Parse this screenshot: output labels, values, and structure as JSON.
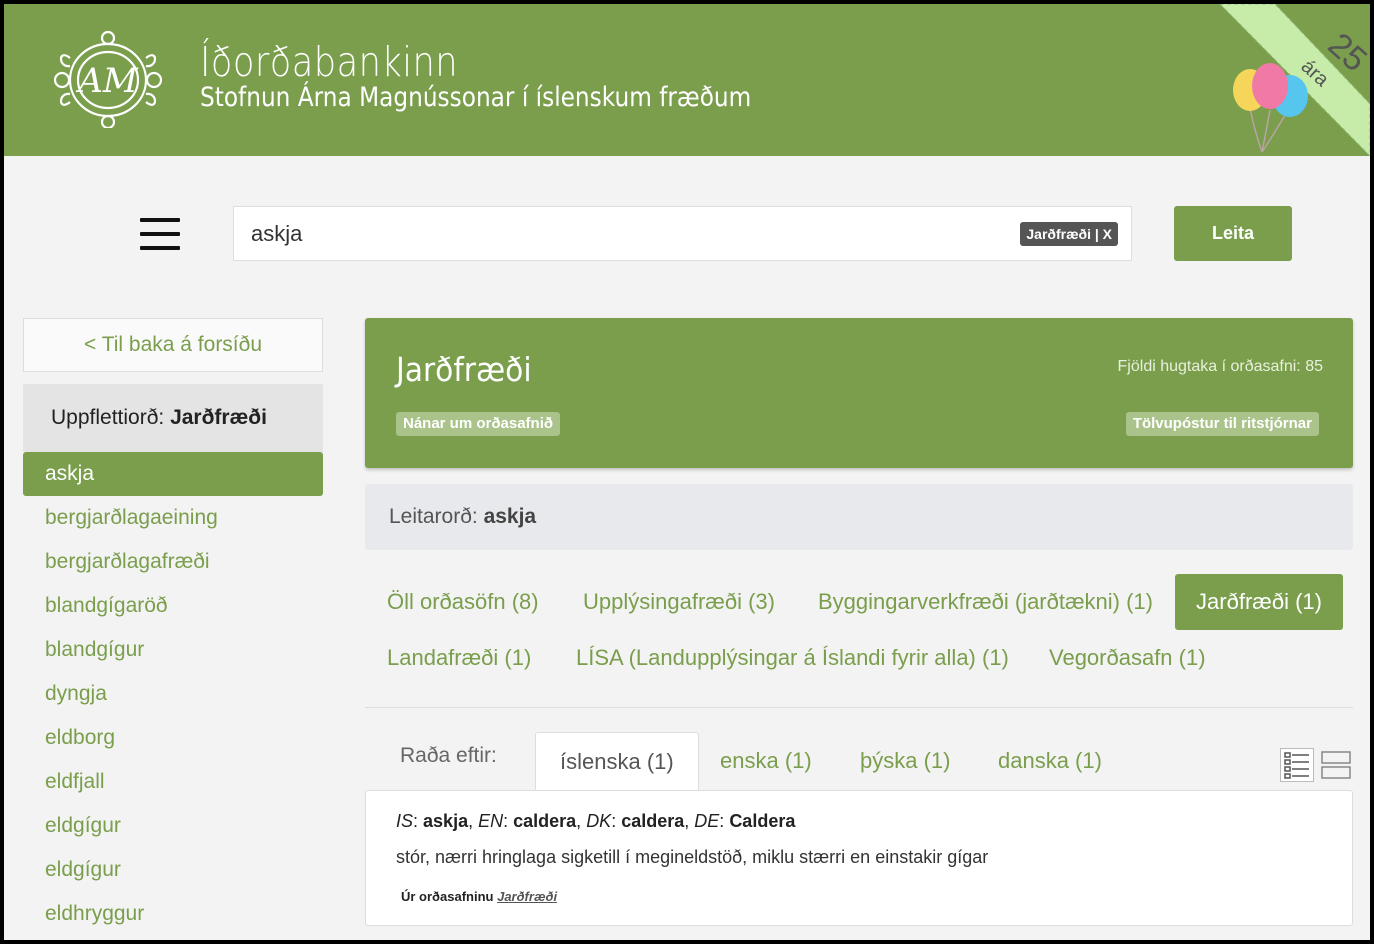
{
  "header": {
    "title": "Íðorðabankinn",
    "subtitle": "Stofnun Árna Magnússonar í íslenskum fræðum",
    "anniversary_number": "25",
    "anniversary_word": "ára",
    "logo_text": "AM",
    "color": "#7a9e4c"
  },
  "search": {
    "value": "askja",
    "filter_tag": "Jarðfræði | X",
    "button_label": "Leita"
  },
  "sidebar": {
    "back_label": "< Til baka á forsíðu",
    "lookup_label": "Uppflettiorð:",
    "lookup_value": "Jarðfræði",
    "words": [
      "askja",
      "bergjarðlagaeining",
      "bergjarðlagafræði",
      "blandgígaröð",
      "blandgígur",
      "dyngja",
      "eldborg",
      "eldfjall",
      "eldgígur",
      "eldgígur",
      "eldhryggur"
    ],
    "active_index": 0
  },
  "dictionary": {
    "title": "Jarðfræði",
    "count_text": "Fjöldi hugtaka í orðasafni: 85",
    "about_label": "Nánar um orðasafnið",
    "email_label": "Tölvupóstur til ritstjórnar"
  },
  "search_term": {
    "label": "Leitarorð:",
    "value": "askja"
  },
  "collections": [
    {
      "label": "Öll orðasöfn (8)"
    },
    {
      "label": "Upplýsingafræði (3)"
    },
    {
      "label": "Byggingarverkfræði (jarðtækni) (1)"
    },
    {
      "label": "Jarðfræði (1)"
    },
    {
      "label": "Landafræði (1)"
    },
    {
      "label": "LÍSA (Landupplýsingar á Íslandi fyrir alla) (1)"
    },
    {
      "label": "Vegorðasafn (1)"
    }
  ],
  "sort": {
    "label": "Raða eftir:",
    "tabs": [
      "íslenska (1)",
      "enska (1)",
      "þýska (1)",
      "danska (1)"
    ],
    "active_index": 0
  },
  "result": {
    "is_code": "IS",
    "is_term": "askja",
    "en_code": "EN",
    "en_term": "caldera",
    "dk_code": "DK",
    "dk_term": "caldera",
    "de_code": "DE",
    "de_term": "Caldera",
    "definition": "stór, nærri hringlaga sigketill í megineldstöð, miklu stærri en einstakir gígar",
    "source_prefix": "Úr orðasafninu",
    "source_name": "Jarðfræði"
  }
}
